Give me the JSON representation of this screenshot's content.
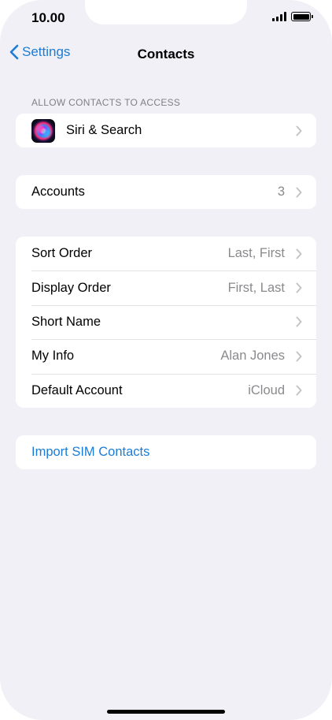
{
  "status_bar": {
    "time": "10.00"
  },
  "nav": {
    "back_label": "Settings",
    "title": "Contacts"
  },
  "section_access": {
    "header": "ALLOW CONTACTS TO ACCESS",
    "siri_label": "Siri & Search"
  },
  "accounts": {
    "label": "Accounts",
    "value": "3"
  },
  "settings_rows": [
    {
      "label": "Sort Order",
      "value": "Last, First"
    },
    {
      "label": "Display Order",
      "value": "First, Last"
    },
    {
      "label": "Short Name",
      "value": ""
    },
    {
      "label": "My Info",
      "value": "Alan Jones"
    },
    {
      "label": "Default Account",
      "value": "iCloud"
    }
  ],
  "import": {
    "label": "Import SIM Contacts"
  },
  "colors": {
    "background": "#f1f0f6",
    "accent": "#1a7cd6",
    "secondary_text": "#8a8a8e"
  },
  "icons": [
    "back-chevron-icon",
    "chevron-right-icon",
    "siri-icon",
    "signal-icon",
    "battery-icon"
  ]
}
